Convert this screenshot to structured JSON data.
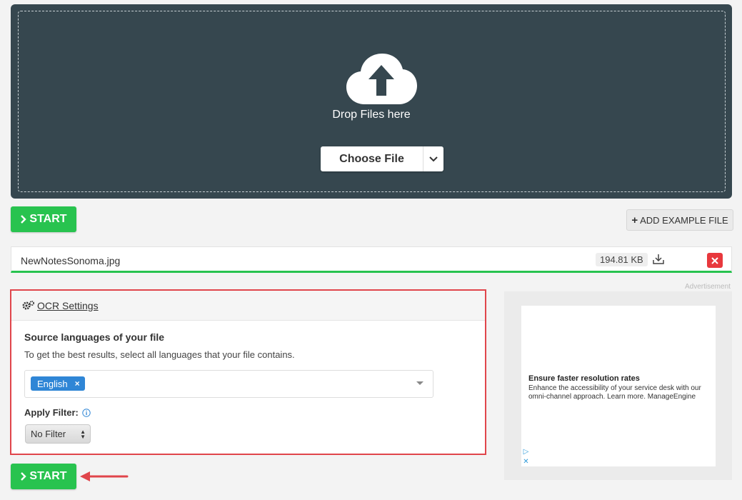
{
  "upload": {
    "drop_text": "Drop Files here",
    "choose_label": "Choose File",
    "icon": "cloud-upload-icon"
  },
  "actions": {
    "start_label": "START",
    "add_example_label": "ADD EXAMPLE FILE"
  },
  "file": {
    "name": "NewNotesSonoma.jpg",
    "size": "194.81 KB"
  },
  "ocr": {
    "title": "OCR Settings",
    "source_label": "Source languages of your file",
    "source_hint": "To get the best results, select all languages that your file contains.",
    "selected_language": "English",
    "filter_label": "Apply Filter:",
    "filter_value": "No Filter"
  },
  "ad": {
    "label": "Advertisement",
    "headline": "Ensure faster resolution rates",
    "body": "Enhance the accessibility of your service desk with our omni-channel approach. Learn more. ManageEngine"
  },
  "colors": {
    "accent_green": "#28c34f",
    "dropzone_bg": "#36474f",
    "highlight_red": "#e0454b",
    "tag_blue": "#2f86d6"
  }
}
